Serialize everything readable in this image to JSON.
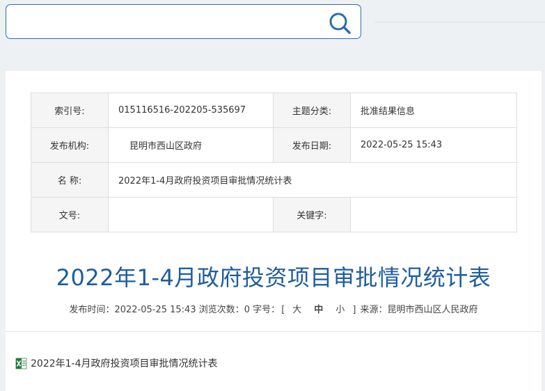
{
  "search": {
    "placeholder": "",
    "value": ""
  },
  "meta": {
    "index_label": "索引号:",
    "index_value": "015116516-202205-535697",
    "topic_label": "主题分类:",
    "topic_value": "批准结果信息",
    "org_label": "发布机构:",
    "org_value": "昆明市西山区政府",
    "date_label": "发布日期:",
    "date_value": "2022-05-25 15:43",
    "name_label": "名 称:",
    "name_value": "2022年1-4月政府投资项目审批情况统计表",
    "docno_label": "文号:",
    "docno_value": "",
    "keyword_label": "关键字:",
    "keyword_value": ""
  },
  "article": {
    "title": "2022年1-4月政府投资项目审批情况统计表",
    "publish_time": "发布时间：2022-05-25 15:43",
    "views": "浏览次数：0",
    "font_size_label": "字号：",
    "bracket_open": "[",
    "size_large": "大",
    "size_medium": "中",
    "size_small": "小",
    "bracket_close": "]",
    "source": "来源：昆明市西山区人民政府"
  },
  "attachment": {
    "icon": "excel-file-icon",
    "name": "2022年1-4月政府投资项目审批情况统计表"
  },
  "colors": {
    "accent": "#1d5d9e",
    "search_border": "#2a6cae",
    "background": "#eef1f4",
    "label_bg": "#f5f5f5"
  }
}
